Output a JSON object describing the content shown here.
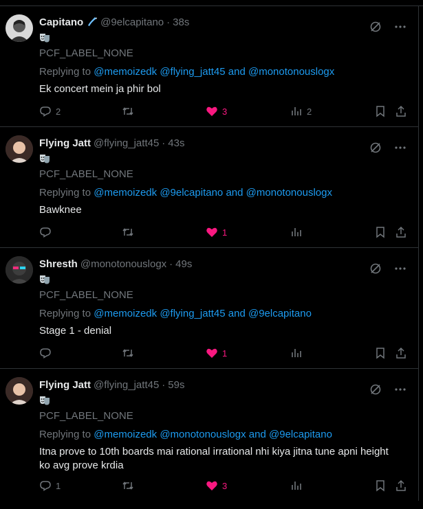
{
  "replying_label": "Replying to",
  "and_label": "and",
  "tweets": [
    {
      "name": "Capitano",
      "handle": "@9elcapitano",
      "time": "38s",
      "label": "PCF_LABEL_NONE",
      "mentions": [
        "@memoizedk",
        "@flying_jatt45",
        "@monotonouslogx"
      ],
      "text": "Ek concert mein ja phir bol",
      "replies": "2",
      "retweets": "",
      "likes": "3",
      "views": "2"
    },
    {
      "name": "Flying Jatt",
      "handle": "@flying_jatt45",
      "time": "43s",
      "label": "PCF_LABEL_NONE",
      "mentions": [
        "@memoizedk",
        "@9elcapitano",
        "@monotonouslogx"
      ],
      "text": "Bawknee",
      "replies": "",
      "retweets": "",
      "likes": "1",
      "views": ""
    },
    {
      "name": "Shresth",
      "handle": "@monotonouslogx",
      "time": "49s",
      "label": "PCF_LABEL_NONE",
      "mentions": [
        "@memoizedk",
        "@flying_jatt45",
        "@9elcapitano"
      ],
      "text": "Stage 1 - denial",
      "replies": "",
      "retweets": "",
      "likes": "1",
      "views": ""
    },
    {
      "name": "Flying Jatt",
      "handle": "@flying_jatt45",
      "time": "59s",
      "label": "PCF_LABEL_NONE",
      "mentions": [
        "@memoizedk",
        "@monotonouslogx",
        "@9elcapitano"
      ],
      "text": "Itna prove to 10th boards mai rational irrational nhi kiya jitna tune apni height ko avg prove krdia",
      "replies": "1",
      "retweets": "",
      "likes": "3",
      "views": ""
    }
  ],
  "colors": {
    "background": "#000000",
    "muted": "#71767b",
    "mention": "#1d9bf0",
    "like": "#f91880",
    "text": "#e7e9ea",
    "border": "#2f3336"
  },
  "icons": [
    "reply-icon",
    "retweet-icon",
    "like-icon",
    "views-icon",
    "bookmark-icon",
    "share-icon",
    "grok-icon",
    "more-icon",
    "theater-masks-icon",
    "verified-badge-icon"
  ]
}
